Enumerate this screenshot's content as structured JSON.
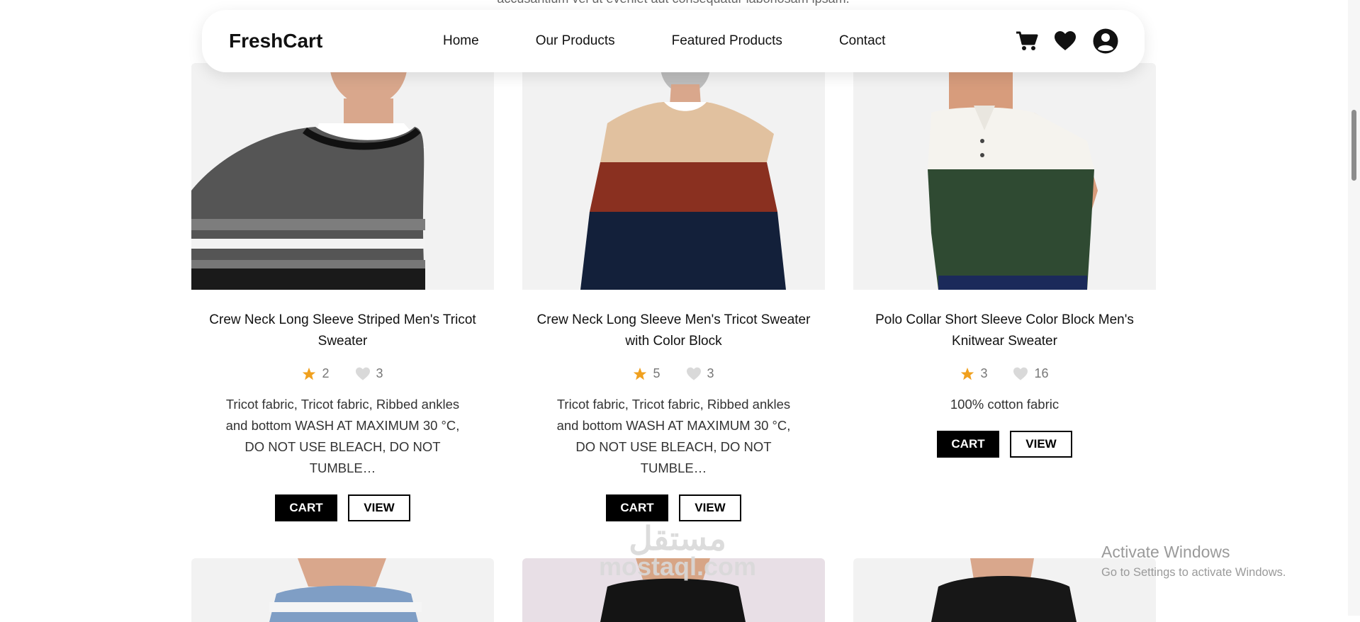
{
  "top_text": "accusantium vel ut eveniet aut consequatur laboriosam ipsam.",
  "navbar": {
    "brand": "FreshCart",
    "links": [
      "Home",
      "Our Products",
      "Featured Products",
      "Contact"
    ],
    "icons": [
      "cart-icon",
      "heart-icon",
      "user-icon"
    ]
  },
  "products": [
    {
      "title": "Crew Neck Long Sleeve Striped Men's Tricot Sweater",
      "rating": "2",
      "likes": "3",
      "description": "Tricot fabric, Tricot fabric, Ribbed ankles and bottom WASH AT MAXIMUM 30 °C, DO NOT USE BLEACH, DO NOT TUMBLE…",
      "cart_label": "CART",
      "view_label": "VIEW"
    },
    {
      "title": "Crew Neck Long Sleeve Men's Tricot Sweater with Color Block",
      "rating": "5",
      "likes": "3",
      "description": "Tricot fabric, Tricot fabric, Ribbed ankles and bottom WASH AT MAXIMUM 30 °C, DO NOT USE BLEACH, DO NOT TUMBLE…",
      "cart_label": "CART",
      "view_label": "VIEW"
    },
    {
      "title": "Polo Collar Short Sleeve Color Block Men's Knitwear Sweater",
      "rating": "3",
      "likes": "16",
      "description": "100% cotton fabric",
      "cart_label": "CART",
      "view_label": "VIEW"
    }
  ],
  "colors": {
    "star": "#f0a01e",
    "heart": "#d9d9d9",
    "button_dark": "#000000"
  },
  "watermark": {
    "arabic": "مستقل",
    "latin": "mostaql.com"
  },
  "os_notice": {
    "title": "Activate Windows",
    "subtitle": "Go to Settings to activate Windows."
  }
}
